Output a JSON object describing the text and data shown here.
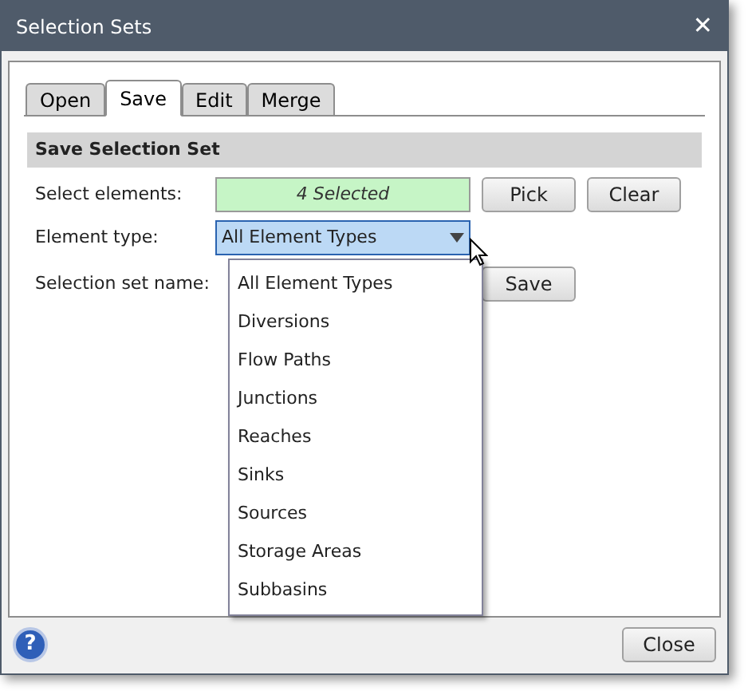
{
  "window": {
    "title": "Selection Sets",
    "close": "✕"
  },
  "tabs": [
    {
      "label": "Open",
      "selected": false
    },
    {
      "label": "Save",
      "selected": true
    },
    {
      "label": "Edit",
      "selected": false
    },
    {
      "label": "Merge",
      "selected": false
    }
  ],
  "section": {
    "title": "Save Selection Set"
  },
  "select_elements": {
    "label": "Select elements:",
    "value": "4 Selected",
    "buttons": [
      "Pick",
      "Clear"
    ]
  },
  "element_type": {
    "label": "Element type:",
    "value": "All Element Types",
    "expanded": true,
    "options": [
      {
        "label": "All Element Types"
      },
      {
        "label": "Diversions"
      },
      {
        "label": "Flow Paths"
      },
      {
        "label": "Junctions"
      },
      {
        "label": "Reaches"
      },
      {
        "label": "Sinks"
      },
      {
        "label": "Sources"
      },
      {
        "label": "Storage Areas"
      },
      {
        "label": "Subbasins"
      }
    ]
  },
  "selection_set_name": {
    "label": "Selection set name:",
    "button": "Save"
  },
  "footer": {
    "help": "?",
    "button": "Close"
  }
}
